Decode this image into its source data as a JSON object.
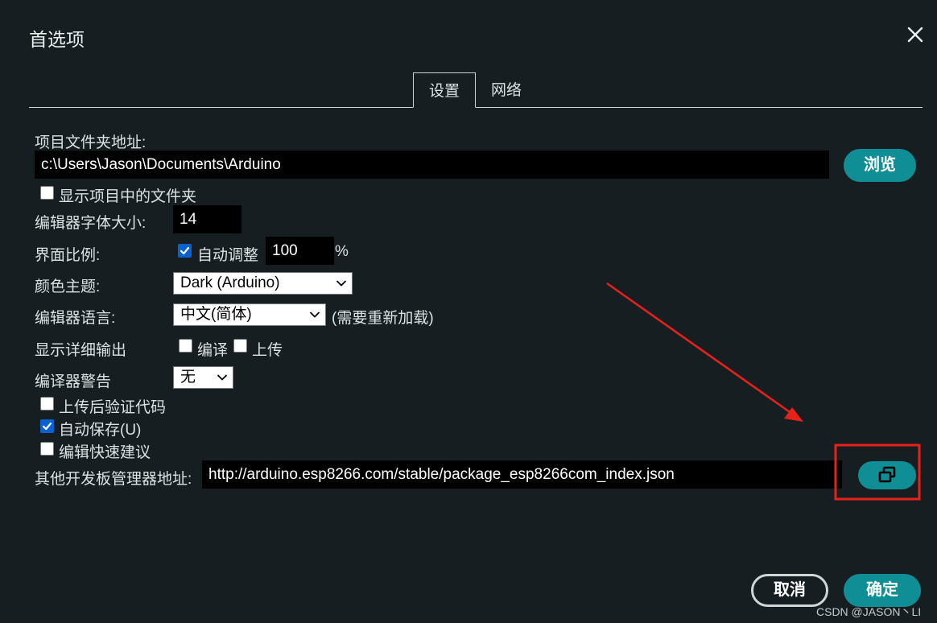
{
  "dialog": {
    "title": "首选项"
  },
  "tabs": [
    {
      "label": "设置",
      "active": true
    },
    {
      "label": "网络",
      "active": false
    }
  ],
  "sketchbook": {
    "label": "项目文件夹地址:",
    "value": "c:\\Users\\Jason\\Documents\\Arduino",
    "browse_label": "浏览"
  },
  "show_files": {
    "label": "显示项目中的文件夹",
    "checked": false
  },
  "font_size": {
    "label": "编辑器字体大小:",
    "value": "14"
  },
  "scale": {
    "label": "界面比例:",
    "auto_label": "自动调整",
    "auto_checked": true,
    "value": "100",
    "unit": "%"
  },
  "theme": {
    "label": "颜色主题:",
    "selected": "Dark (Arduino)"
  },
  "language": {
    "label": "编辑器语言:",
    "selected": "中文(简体)",
    "note": "(需要重新加载)"
  },
  "verbose": {
    "label": "显示详细输出",
    "compile_label": "编译",
    "compile_checked": false,
    "upload_label": "上传",
    "upload_checked": false
  },
  "warnings": {
    "label": "编译器警告",
    "selected": "无"
  },
  "verify_after_upload": {
    "label": "上传后验证代码",
    "checked": false
  },
  "auto_save": {
    "label": "自动保存(U)",
    "checked": true
  },
  "quick_suggestions": {
    "label": "编辑快速建议",
    "checked": false
  },
  "board_manager": {
    "label": "其他开发板管理器地址:",
    "value": "http://arduino.esp8266.com/stable/package_esp8266com_index.json"
  },
  "footer": {
    "cancel_label": "取消",
    "ok_label": "确定"
  },
  "watermark": "CSDN @JASON丶LI",
  "colors": {
    "accent": "#0f8f95",
    "background": "#171e21",
    "annotation": "#e8221b"
  }
}
